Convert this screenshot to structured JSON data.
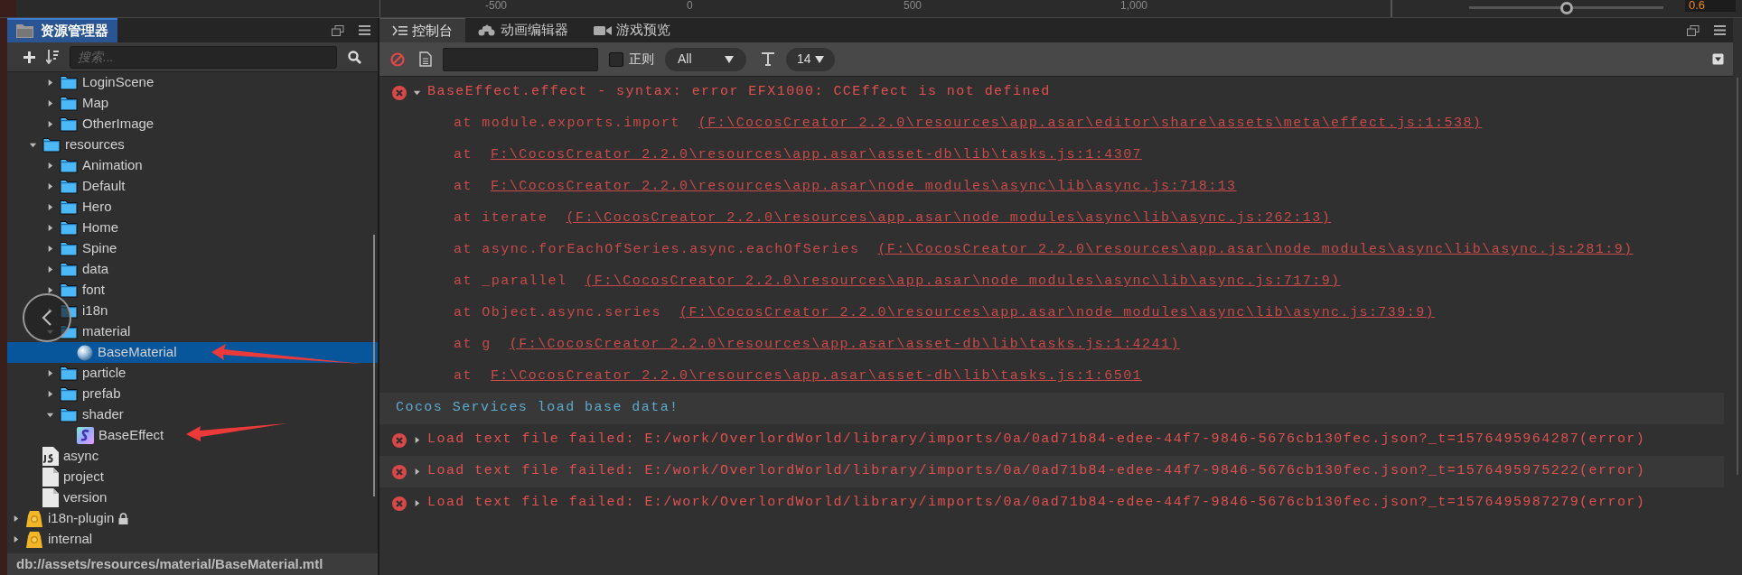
{
  "top_strip": {
    "ruler_labels": [
      "-500",
      "0",
      "500",
      "1,000"
    ],
    "slider": {
      "level": 0.5
    },
    "value": "0.6"
  },
  "assets_panel": {
    "title": "资源管理器",
    "search": {
      "placeholder": "搜索..."
    },
    "tree": [
      {
        "children": [
          {
            "children": [
              {
                "label": "LoginScene",
                "kind": "folder",
                "expanded": false,
                "selected": false
              },
              {
                "label": "Map",
                "kind": "folder",
                "expanded": false,
                "selected": false
              },
              {
                "label": "OtherImage",
                "kind": "folder",
                "expanded": false,
                "selected": false
              }
            ]
          },
          {
            "label": "resources",
            "kind": "folder",
            "expanded": true,
            "selected": false,
            "children": [
              {
                "label": "Animation",
                "kind": "folder",
                "expanded": false,
                "selected": false
              },
              {
                "label": "Default",
                "kind": "folder",
                "expanded": false,
                "selected": false
              },
              {
                "label": "Hero",
                "kind": "folder",
                "expanded": false,
                "selected": false
              },
              {
                "label": "Home",
                "kind": "folder",
                "expanded": false,
                "selected": false
              },
              {
                "label": "Spine",
                "kind": "folder",
                "expanded": false,
                "selected": false
              },
              {
                "label": "data",
                "kind": "folder",
                "expanded": false,
                "selected": false
              },
              {
                "label": "font",
                "kind": "folder",
                "expanded": false,
                "selected": false
              },
              {
                "label": "i18n",
                "kind": "folder",
                "expanded": false,
                "selected": false
              },
              {
                "label": "material",
                "kind": "folder",
                "expanded": true,
                "selected": false,
                "children": [
                  {
                    "label": "BaseMaterial",
                    "kind": "material",
                    "selected": true
                  }
                ]
              },
              {
                "label": "particle",
                "kind": "folder",
                "expanded": false,
                "selected": false
              },
              {
                "label": "prefab",
                "kind": "folder",
                "expanded": false,
                "selected": false
              },
              {
                "label": "shader",
                "kind": "folder",
                "expanded": true,
                "selected": false,
                "children": [
                  {
                    "label": "BaseEffect",
                    "kind": "effect",
                    "selected": false
                  }
                ]
              }
            ]
          },
          {
            "label": "async",
            "kind": "script",
            "selected": false
          },
          {
            "label": "project",
            "kind": "file",
            "selected": false
          },
          {
            "label": "version",
            "kind": "file",
            "selected": false
          }
        ]
      },
      {
        "label": "i18n-plugin",
        "kind": "package",
        "expanded": false,
        "selected": false,
        "locked": true
      },
      {
        "label": "internal",
        "kind": "package",
        "expanded": false,
        "selected": false,
        "locked": false
      }
    ],
    "status_bar": "db://assets/resources/material/BaseMaterial.mtl"
  },
  "console_panel": {
    "tabs": [
      {
        "label": "控制台",
        "kind": "console",
        "selected": true
      },
      {
        "label": "动画编辑器",
        "kind": "animation",
        "selected": false
      },
      {
        "label": "游戏预览",
        "kind": "preview",
        "selected": false
      }
    ],
    "toolbar": {
      "regex": {
        "label": "正则",
        "checked": false
      },
      "level_filter": "All",
      "font_size": "14"
    },
    "logs": [
      {
        "kind": "error",
        "expanded": true,
        "message": "BaseEffect.effect - syntax: error EFX1000: CCEffect is not defined",
        "stack": [
          {
            "caller": "at module.exports.import",
            "link": "(F:\\CocosCreator_2.2.0\\resources\\app.asar\\editor\\share\\assets\\meta\\effect.js:1:538)"
          },
          {
            "caller": "at",
            "link": "F:\\CocosCreator_2.2.0\\resources\\app.asar\\asset-db\\lib\\tasks.js:1:4307"
          },
          {
            "caller": "at",
            "link": "F:\\CocosCreator_2.2.0\\resources\\app.asar\\node_modules\\async\\lib\\async.js:718:13"
          },
          {
            "caller": "at iterate",
            "link": "(F:\\CocosCreator_2.2.0\\resources\\app.asar\\node_modules\\async\\lib\\async.js:262:13)"
          },
          {
            "caller": "at async.forEachOfSeries.async.eachOfSeries",
            "link": "(F:\\CocosCreator_2.2.0\\resources\\app.asar\\node_modules\\async\\lib\\async.js:281:9)"
          },
          {
            "caller": "at _parallel",
            "link": "(F:\\CocosCreator_2.2.0\\resources\\app.asar\\node_modules\\async\\lib\\async.js:717:9)"
          },
          {
            "caller": "at Object.async.series",
            "link": "(F:\\CocosCreator_2.2.0\\resources\\app.asar\\node_modules\\async\\lib\\async.js:739:9)"
          },
          {
            "caller": "at g",
            "link": "(F:\\CocosCreator_2.2.0\\resources\\app.asar\\asset-db\\lib\\tasks.js:1:4241)"
          },
          {
            "caller": "at",
            "link": "F:\\CocosCreator_2.2.0\\resources\\app.asar\\asset-db\\lib\\tasks.js:1:6501"
          }
        ]
      },
      {
        "kind": "info",
        "message": "Cocos Services load base data!"
      },
      {
        "kind": "error",
        "expanded": false,
        "message": "Load text file failed: E:/work/OverlordWorld/library/imports/0a/0ad71b84-edee-44f7-9846-5676cb130fec.json?_t=1576495964287(error)"
      },
      {
        "kind": "error",
        "expanded": false,
        "message": "Load text file failed: E:/work/OverlordWorld/library/imports/0a/0ad71b84-edee-44f7-9846-5676cb130fec.json?_t=1576495975222(error)"
      },
      {
        "kind": "error",
        "expanded": false,
        "message": "Load text file failed: E:/work/OverlordWorld/library/imports/0a/0ad71b84-edee-44f7-9846-5676cb130fec.json?_t=1576495987279(error)"
      }
    ]
  }
}
